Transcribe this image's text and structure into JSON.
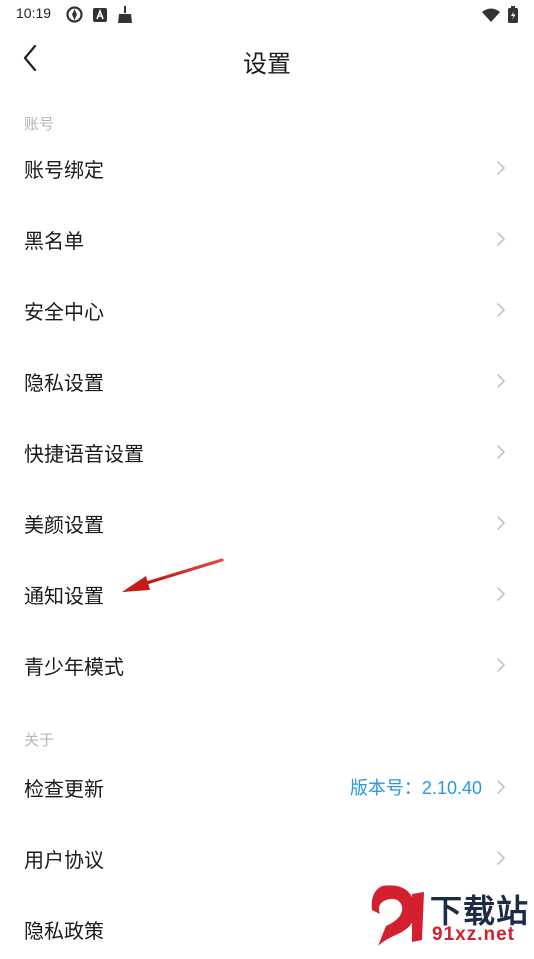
{
  "status_bar": {
    "time": "10:19",
    "left_icons": [
      "sync-icon",
      "a-badge-icon",
      "broom-icon"
    ],
    "right_icons": [
      "wifi-icon",
      "battery-icon"
    ]
  },
  "header": {
    "title": "设置",
    "back_icon": "chevron-left-icon"
  },
  "sections": [
    {
      "label": "账号",
      "items": [
        {
          "label": "账号绑定"
        },
        {
          "label": "黑名单"
        },
        {
          "label": "安全中心"
        },
        {
          "label": "隐私设置"
        },
        {
          "label": "快捷语音设置"
        },
        {
          "label": "美颜设置"
        },
        {
          "label": "通知设置"
        },
        {
          "label": "青少年模式"
        }
      ]
    },
    {
      "label": "关于",
      "items": [
        {
          "label": "检查更新",
          "value": "版本号：2.10.40"
        },
        {
          "label": "用户协议"
        },
        {
          "label": "隐私政策"
        }
      ]
    }
  ],
  "annotation": {
    "icon": "red-arrow-icon",
    "color": "#d9211f"
  },
  "watermark": {
    "title": "下载站",
    "url": "91xz.net",
    "colors": {
      "title": "#1d2b45",
      "url": "#d4202e"
    }
  },
  "colors": {
    "accent": "#2a96e6",
    "section_label": "#b5b5b5",
    "chevron": "#c4c4c4"
  }
}
